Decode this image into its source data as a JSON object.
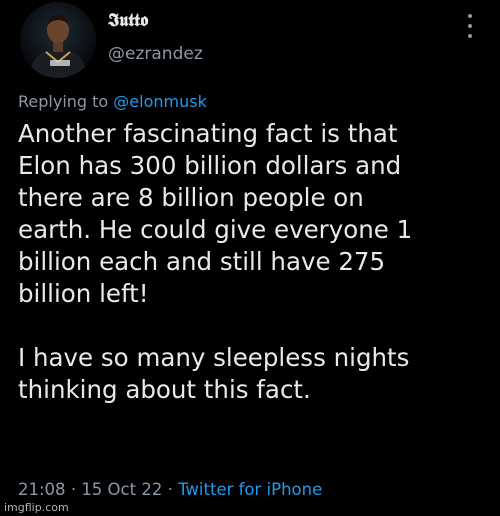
{
  "author": {
    "display_name": "𝕴𝖚𝖙𝖙𝖔",
    "handle": "@ezrandez",
    "avatar_icon": "avatar-photo"
  },
  "reply": {
    "prefix": "Replying to",
    "mention": "@elonmusk"
  },
  "tweet": {
    "paragraph_1_lines": [
      "Another fascinating fact is that",
      "Elon has 300 billion dollars and",
      "there are 8 billion people on",
      "earth. He could give everyone 1",
      "billion each and still have 275",
      "billion left!"
    ],
    "paragraph_2_lines": [
      "I have so many sleepless nights",
      "thinking about this fact."
    ]
  },
  "meta": {
    "time": "21:08",
    "separator": "·",
    "date": "15 Oct 22",
    "source": "Twitter for iPhone"
  },
  "watermark": "imgflip.com",
  "colors": {
    "background": "#000000",
    "text": "#e7e9ea",
    "secondary": "#8b98a5",
    "accent": "#1d9bf0"
  }
}
